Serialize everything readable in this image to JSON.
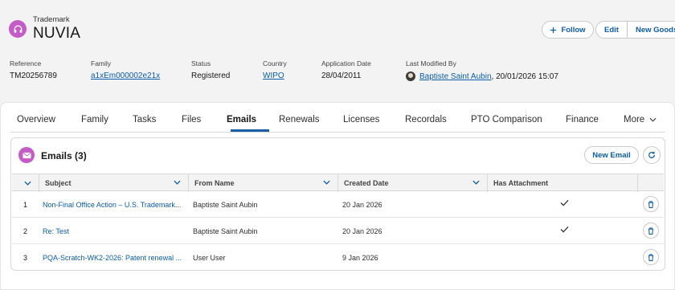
{
  "record": {
    "object_type": "Trademark",
    "title": "NUVIA",
    "icon": "trademark-headphones-icon",
    "accent_color": "#c65ac8"
  },
  "actions": {
    "follow": "Follow",
    "edit": "Edit",
    "new_goods": "New Goods"
  },
  "fields": {
    "reference": {
      "label": "Reference",
      "value": "TM20256789"
    },
    "family": {
      "label": "Family",
      "value": "a1xEm000002e21x"
    },
    "status": {
      "label": "Status",
      "value": "Registered"
    },
    "country": {
      "label": "Country",
      "value": "WIPO"
    },
    "application_date": {
      "label": "Application Date",
      "value": "28/04/2011"
    },
    "last_modified": {
      "label": "Last Modified By",
      "user": "Baptiste Saint Aubin",
      "datetime": ", 20/01/2026 15:07"
    }
  },
  "tabs": [
    {
      "label": "Overview"
    },
    {
      "label": "Family"
    },
    {
      "label": "Tasks"
    },
    {
      "label": "Files"
    },
    {
      "label": "Emails",
      "active": true
    },
    {
      "label": "Renewals"
    },
    {
      "label": "Licenses"
    },
    {
      "label": "Recordals"
    },
    {
      "label": "PTO Comparison"
    },
    {
      "label": "Finance"
    },
    {
      "label": "More"
    }
  ],
  "emails": {
    "title": "Emails (3)",
    "new_button": "New Email",
    "columns": [
      "Subject",
      "From Name",
      "Created Date",
      "Has Attachment"
    ],
    "rows": [
      {
        "num": "1",
        "subject": "Non-Final Office Action – U.S. Trademark...",
        "from": "Baptiste Saint Aubin",
        "created": "20 Jan 2026",
        "attachment": true
      },
      {
        "num": "2",
        "subject": "Re: Test",
        "from": "Baptiste Saint Aubin",
        "created": "20 Jan 2026",
        "attachment": true
      },
      {
        "num": "3",
        "subject": "PQA-Scratch-WK2-2026: Patent renewal ...",
        "from": "User User",
        "created": "9 Jan 2026",
        "attachment": false
      }
    ]
  }
}
